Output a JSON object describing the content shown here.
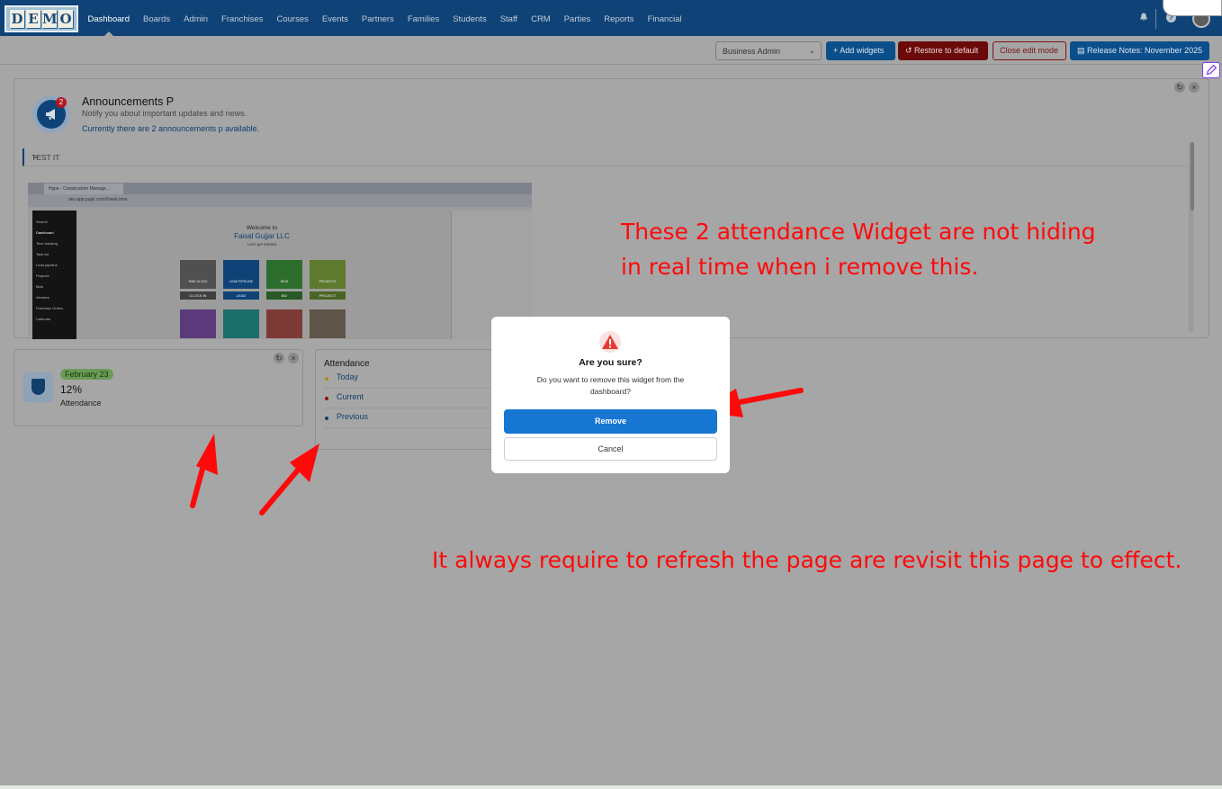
{
  "app": {
    "logo_letters": [
      "D",
      "E",
      "M",
      "O"
    ],
    "nav": [
      "Dashboard",
      "Boards",
      "Admin",
      "Franchises",
      "Courses",
      "Events",
      "Partners",
      "Families",
      "Students",
      "Staff",
      "CRM",
      "Parties",
      "Reports",
      "Financial"
    ],
    "active_nav": "Dashboard",
    "icons": [
      "bell-icon",
      "help-icon",
      "user-avatar"
    ]
  },
  "toolbar": {
    "role_select": "Business Admin",
    "add_widgets": "+ Add widgets",
    "restore": "Restore to default",
    "close_edit": "Close edit mode",
    "release_notes": "Release Notes: November 2025"
  },
  "announcements": {
    "badge": "2",
    "title": "Announcements P",
    "subtitle": "Notify you about important updates and news.",
    "count_text": "Currently there are 2 announcements p available.",
    "item_label": "TEST IT",
    "screenshot": {
      "tab": "Hype - Construction Manage...",
      "url": "dev.app.pupil.com/#/welcome",
      "welcome": "Welcome to",
      "company": "Faisal Gujjar LLC",
      "started": "Let's get started",
      "sidebar": [
        "Search",
        "Dashboard",
        "Time tracking",
        "Task list",
        "Lead pipeline",
        "Projects",
        "Bids",
        "Vendors",
        "Purchase Orders",
        "Calendar"
      ],
      "tiles": [
        "TIME CLOCK",
        "LEAD PIPELINE",
        "BIDS",
        "PROJECTS"
      ],
      "tile_buttons": [
        "CLOCK IN",
        "LEAD",
        "BID",
        "PROJECT"
      ]
    }
  },
  "attendance_card": {
    "date": "February 23",
    "percent": "12%",
    "label": "Attendance"
  },
  "attendance_list": {
    "title": "Attendance",
    "items": [
      "Today",
      "Current",
      "Previous"
    ]
  },
  "modal": {
    "title": "Are you sure?",
    "message": "Do you want to remove this widget from the dashboard?",
    "confirm": "Remove",
    "cancel": "Cancel"
  },
  "annotations": {
    "line1": "These 2 attendance Widget are not hiding",
    "line2": "in real time when i remove this.",
    "bottom": "It always require to refresh the page are revisit this page to effect."
  },
  "colors": {
    "nav_bg": "#0f4378",
    "overlay_bg": "#a6a6a6",
    "remove_btn": "#1676d2",
    "annotation": "#ff0a0a"
  }
}
